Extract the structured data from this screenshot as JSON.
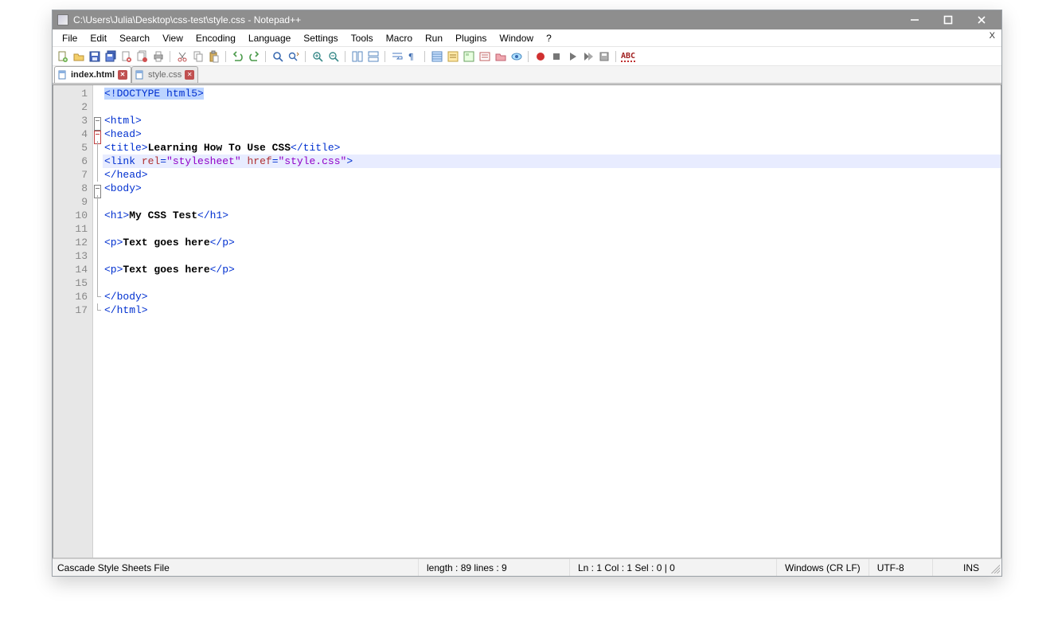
{
  "titlebar": {
    "title": "C:\\Users\\Julia\\Desktop\\css-test\\style.css - Notepad++"
  },
  "menubar": {
    "items": [
      "File",
      "Edit",
      "Search",
      "View",
      "Encoding",
      "Language",
      "Settings",
      "Tools",
      "Macro",
      "Run",
      "Plugins",
      "Window",
      "?"
    ],
    "close_x": "X"
  },
  "toolbar_icons": [
    "new-file-icon",
    "open-file-icon",
    "save-icon",
    "save-all-icon",
    "close-file-icon",
    "close-all-icon",
    "print-icon",
    "sep",
    "cut-icon",
    "copy-icon",
    "paste-icon",
    "sep",
    "undo-icon",
    "redo-icon",
    "sep",
    "find-icon",
    "replace-icon",
    "sep",
    "zoom-in-icon",
    "zoom-out-icon",
    "sep",
    "sync-v-icon",
    "sync-h-icon",
    "sep",
    "wordwrap-icon",
    "all-chars-icon",
    "sep",
    "indent-guide-icon",
    "lang-udl-icon",
    "doc-map-icon",
    "func-list-icon",
    "folder-tree-icon",
    "monitor-icon",
    "sep",
    "record-macro-icon",
    "stop-macro-icon",
    "play-macro-icon",
    "play-multi-icon",
    "save-macro-icon",
    "sep",
    "spellcheck-abc-icon"
  ],
  "tabs": [
    {
      "label": "index.html",
      "active": true
    },
    {
      "label": "style.css",
      "active": false
    }
  ],
  "editor": {
    "current_line_index": 5,
    "lines": [
      {
        "n": 1,
        "fold": "",
        "tokens": [
          {
            "t": "sel",
            "v": "<!DOCTYPE html5>"
          }
        ]
      },
      {
        "n": 2,
        "fold": "",
        "tokens": []
      },
      {
        "n": 3,
        "fold": "minus",
        "tokens": [
          {
            "t": "tag",
            "v": "<html>"
          }
        ]
      },
      {
        "n": 4,
        "fold": "minus red",
        "tokens": [
          {
            "t": "tag",
            "v": "<head>"
          }
        ]
      },
      {
        "n": 5,
        "fold": "line",
        "tokens": [
          {
            "t": "tag",
            "v": "<title>"
          },
          {
            "t": "text",
            "v": "Learning How To Use CSS"
          },
          {
            "t": "tag",
            "v": "</title>"
          }
        ]
      },
      {
        "n": 6,
        "fold": "line",
        "tokens": [
          {
            "t": "tag",
            "v": "<link "
          },
          {
            "t": "attr",
            "v": "rel"
          },
          {
            "t": "tag",
            "v": "="
          },
          {
            "t": "val",
            "v": "\"stylesheet\""
          },
          {
            "t": "tag",
            "v": " "
          },
          {
            "t": "attr",
            "v": "href"
          },
          {
            "t": "tag",
            "v": "="
          },
          {
            "t": "val",
            "v": "\"style.css\""
          },
          {
            "t": "tag",
            "v": ">"
          }
        ]
      },
      {
        "n": 7,
        "fold": "line",
        "tokens": [
          {
            "t": "tag",
            "v": "</head>"
          }
        ]
      },
      {
        "n": 8,
        "fold": "minus",
        "tokens": [
          {
            "t": "tag",
            "v": "<body>"
          }
        ]
      },
      {
        "n": 9,
        "fold": "line",
        "tokens": []
      },
      {
        "n": 10,
        "fold": "line",
        "tokens": [
          {
            "t": "tag",
            "v": "<h1>"
          },
          {
            "t": "text",
            "v": "My CSS Test"
          },
          {
            "t": "tag",
            "v": "</h1>"
          }
        ]
      },
      {
        "n": 11,
        "fold": "line",
        "tokens": []
      },
      {
        "n": 12,
        "fold": "line",
        "tokens": [
          {
            "t": "tag",
            "v": "<p>"
          },
          {
            "t": "text",
            "v": "Text goes here"
          },
          {
            "t": "tag",
            "v": "</p>"
          }
        ]
      },
      {
        "n": 13,
        "fold": "line",
        "tokens": []
      },
      {
        "n": 14,
        "fold": "line",
        "tokens": [
          {
            "t": "tag",
            "v": "<p>"
          },
          {
            "t": "text",
            "v": "Text goes here"
          },
          {
            "t": "tag",
            "v": "</p>"
          }
        ]
      },
      {
        "n": 15,
        "fold": "line",
        "tokens": []
      },
      {
        "n": 16,
        "fold": "end",
        "tokens": [
          {
            "t": "tag",
            "v": "</body>"
          }
        ]
      },
      {
        "n": 17,
        "fold": "end",
        "tokens": [
          {
            "t": "tag",
            "v": "</html>"
          }
        ]
      }
    ]
  },
  "statusbar": {
    "filetype": "Cascade Style Sheets File",
    "length_lines": "length : 89    lines : 9",
    "pos": "Ln : 1    Col : 1    Sel : 0 | 0",
    "eol": "Windows (CR LF)",
    "encoding": "UTF-8",
    "mode": "INS"
  }
}
